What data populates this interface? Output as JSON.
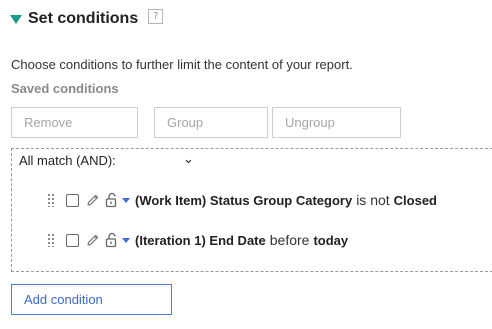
{
  "header": {
    "title": "Set conditions",
    "help_glyph": "?"
  },
  "description": "Choose conditions to further limit the content of your report.",
  "saved_conditions_label": "Saved conditions",
  "toolbar": {
    "remove_label": "Remove",
    "group_label": "Group",
    "ungroup_label": "Ungroup"
  },
  "match": {
    "label": "All match (AND):",
    "chevron": "⌄"
  },
  "conditions": [
    {
      "field": "(Work Item) Status Group Category",
      "operator": "is not",
      "value": "Closed"
    },
    {
      "field": "(Iteration 1) End Date",
      "operator": "before",
      "value": "today"
    }
  ],
  "add_condition_label": "Add condition",
  "colors": {
    "accent": "#1a9b8c",
    "link": "#3a6bc4",
    "caret": "#3a6fd8"
  }
}
